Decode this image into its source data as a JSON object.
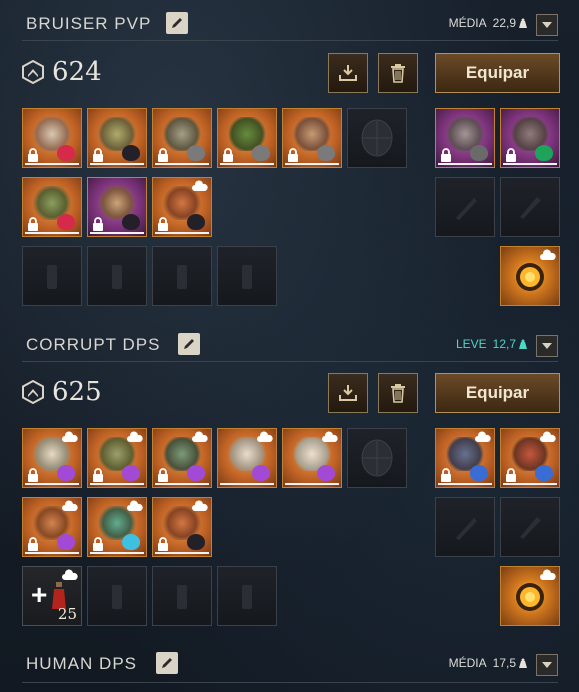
{
  "loadouts": [
    {
      "name": "BRUISER PVP",
      "weight_label": "MÉDIA",
      "weight_value": "22,9",
      "weight_color": "#e6e1d5",
      "gear_score": "624",
      "equip_label": "Equipar",
      "armor_row1": [
        {
          "icon": "helmet-icon",
          "gem": "#d62a4a",
          "style": "gear"
        },
        {
          "icon": "chest-armor-icon",
          "gem": "#23202a",
          "style": "gear"
        },
        {
          "icon": "gloves-icon",
          "gem": "#7a7a7a",
          "style": "gear"
        },
        {
          "icon": "legs-armor-icon",
          "gem": "#7a7a7a",
          "style": "gear"
        },
        {
          "icon": "boots-icon",
          "gem": "#7a7a7a",
          "style": "gear"
        }
      ],
      "jewelry": [
        {
          "icon": "amulet-icon",
          "gem": "#d62a4a",
          "style": "gear"
        },
        {
          "icon": "ring-icon",
          "gem": "#23202a",
          "style": "purple"
        },
        {
          "icon": "earring-icon",
          "gem": "#23202a",
          "style": "gear"
        }
      ],
      "weapons": [
        {
          "icon": "great-axe-icon",
          "gem": "#6a6a6a",
          "style": "purple"
        },
        {
          "icon": "hammer-icon",
          "gem": "#1da35a",
          "style": "purple"
        }
      ]
    },
    {
      "name": "CORRUPT DPS",
      "weight_label": "LEVE",
      "weight_value": "12,7",
      "weight_color": "#4fd6c4",
      "gear_score": "625",
      "equip_label": "Equipar",
      "armor_row1": [
        {
          "icon": "helmet-icon",
          "gem": "#a24ad6",
          "style": "gear"
        },
        {
          "icon": "chest-armor-icon",
          "gem": "#a24ad6",
          "style": "gear"
        },
        {
          "icon": "gloves-icon",
          "gem": "#a24ad6",
          "style": "gear"
        },
        {
          "icon": "legs-armor-icon",
          "gem": "#a24ad6",
          "style": "gear"
        },
        {
          "icon": "boots-icon",
          "gem": "#a24ad6",
          "style": "gear"
        }
      ],
      "jewelry": [
        {
          "icon": "amulet-icon",
          "gem": "#a24ad6",
          "style": "gear"
        },
        {
          "icon": "ring-icon",
          "gem": "#3ec0e0",
          "style": "gear"
        },
        {
          "icon": "earring-icon",
          "gem": "#23202a",
          "style": "gear"
        }
      ],
      "weapons": [
        {
          "icon": "void-gauntlet-icon",
          "gem": "#3a6cd6",
          "style": "gear"
        },
        {
          "icon": "spear-icon",
          "gem": "#3a6cd6",
          "style": "gear"
        }
      ],
      "consumable": {
        "icon": "health-potion-icon",
        "count": "25"
      }
    },
    {
      "name": "HUMAN DPS",
      "weight_label": "MÉDIA",
      "weight_value": "17,5",
      "weight_color": "#e6e1d5"
    }
  ]
}
